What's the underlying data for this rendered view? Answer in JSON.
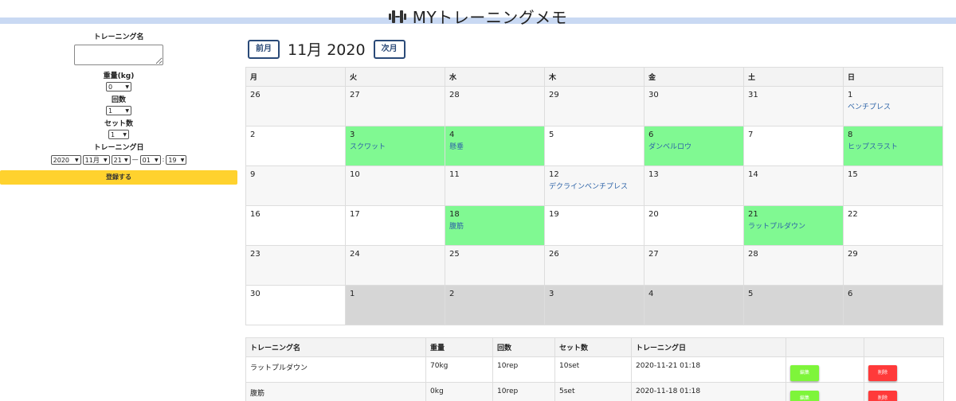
{
  "header": {
    "title": "MYトレーニングメモ",
    "icon": "dumbbell-icon"
  },
  "form": {
    "name_label": "トレーニング名",
    "name_value": "",
    "weight_label": "重量(kg)",
    "weight_value": "0",
    "reps_label": "回数",
    "reps_value": "1",
    "sets_label": "セット数",
    "sets_value": "1",
    "date_label": "トレーニング日",
    "year": "2020",
    "month": "11月",
    "day": "21",
    "dash": "—",
    "hour": "01",
    "colon": ":",
    "minute": "19",
    "submit_label": "登録する",
    "submit_color": "#ffd22e"
  },
  "calendar": {
    "prev_label": "前月",
    "next_label": "次月",
    "month_title": "11月 2020",
    "weekdays": [
      "月",
      "火",
      "水",
      "木",
      "金",
      "土",
      "日"
    ],
    "weeks": [
      [
        {
          "day": "26",
          "event": "",
          "type": "out"
        },
        {
          "day": "27",
          "event": "",
          "type": "out"
        },
        {
          "day": "28",
          "event": "",
          "type": "out"
        },
        {
          "day": "29",
          "event": "",
          "type": "out"
        },
        {
          "day": "30",
          "event": "",
          "type": "out"
        },
        {
          "day": "31",
          "event": "",
          "type": "out"
        },
        {
          "day": "1",
          "event": "ベンチプレス",
          "type": "has"
        }
      ],
      [
        {
          "day": "2",
          "event": "",
          "type": "normal"
        },
        {
          "day": "3",
          "event": "スクワット",
          "type": "has"
        },
        {
          "day": "4",
          "event": "懸垂",
          "type": "has"
        },
        {
          "day": "5",
          "event": "",
          "type": "normal"
        },
        {
          "day": "6",
          "event": "ダンベルロウ",
          "type": "has"
        },
        {
          "day": "7",
          "event": "",
          "type": "normal"
        },
        {
          "day": "8",
          "event": "ヒップスラスト",
          "type": "has"
        }
      ],
      [
        {
          "day": "9",
          "event": "",
          "type": "normal"
        },
        {
          "day": "10",
          "event": "",
          "type": "normal"
        },
        {
          "day": "11",
          "event": "",
          "type": "normal"
        },
        {
          "day": "12",
          "event": "デクラインベンチプレス",
          "type": "has"
        },
        {
          "day": "13",
          "event": "",
          "type": "normal"
        },
        {
          "day": "14",
          "event": "",
          "type": "normal"
        },
        {
          "day": "15",
          "event": "",
          "type": "normal"
        }
      ],
      [
        {
          "day": "16",
          "event": "",
          "type": "normal"
        },
        {
          "day": "17",
          "event": "",
          "type": "normal"
        },
        {
          "day": "18",
          "event": "腹筋",
          "type": "has"
        },
        {
          "day": "19",
          "event": "",
          "type": "normal"
        },
        {
          "day": "20",
          "event": "",
          "type": "normal"
        },
        {
          "day": "21",
          "event": "ラットプルダウン",
          "type": "has"
        },
        {
          "day": "22",
          "event": "",
          "type": "normal"
        }
      ],
      [
        {
          "day": "23",
          "event": "",
          "type": "normal"
        },
        {
          "day": "24",
          "event": "",
          "type": "normal"
        },
        {
          "day": "25",
          "event": "",
          "type": "normal"
        },
        {
          "day": "26",
          "event": "",
          "type": "normal"
        },
        {
          "day": "27",
          "event": "",
          "type": "normal"
        },
        {
          "day": "28",
          "event": "",
          "type": "normal"
        },
        {
          "day": "29",
          "event": "",
          "type": "normal"
        }
      ],
      [
        {
          "day": "30",
          "event": "",
          "type": "normal"
        },
        {
          "day": "1",
          "event": "",
          "type": "out"
        },
        {
          "day": "2",
          "event": "",
          "type": "out"
        },
        {
          "day": "3",
          "event": "",
          "type": "out"
        },
        {
          "day": "4",
          "event": "",
          "type": "out"
        },
        {
          "day": "5",
          "event": "",
          "type": "out"
        },
        {
          "day": "6",
          "event": "",
          "type": "out"
        }
      ]
    ],
    "colors": {
      "has_event": "#80f992",
      "out_of_month": "#d6d6d6",
      "event_text": "#2d63a7"
    }
  },
  "records": {
    "headers": [
      "トレーニング名",
      "重量",
      "回数",
      "セット数",
      "トレーニング日",
      "",
      ""
    ],
    "rows": [
      {
        "name": "ラットプルダウン",
        "weight": "70kg",
        "reps": "10rep",
        "sets": "10set",
        "date": "2020-11-21 01:18",
        "edit": "編集",
        "delete": "削除"
      },
      {
        "name": "腹筋",
        "weight": "0kg",
        "reps": "10rep",
        "sets": "5set",
        "date": "2020-11-18 01:18",
        "edit": "編集",
        "delete": "削除"
      }
    ],
    "edit_color": "#7ef53a",
    "delete_color": "#ff3a3a"
  }
}
